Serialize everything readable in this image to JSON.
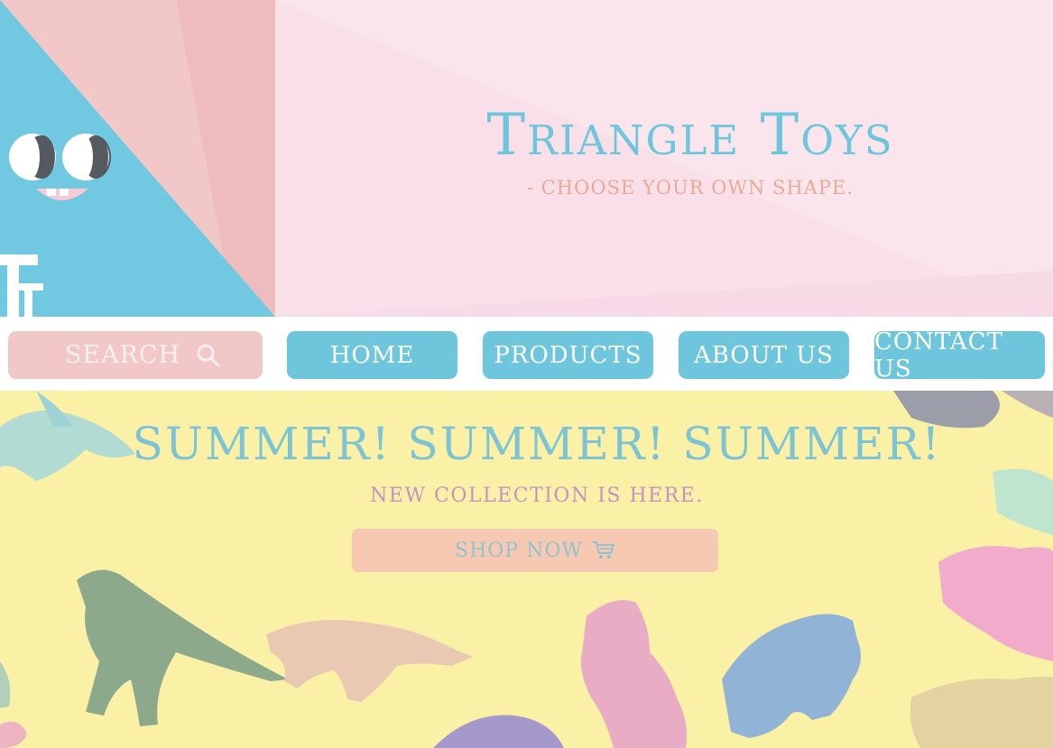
{
  "brand": {
    "title": "Triangle Toys",
    "tagline": "- CHOOSE YOUR OWN SHAPE.",
    "logo_icon": "triangle-face-logo"
  },
  "nav": {
    "search_label": "SEARCH",
    "search_icon": "search-icon",
    "items": [
      {
        "label": "HOME"
      },
      {
        "label": "PRODUCTS"
      },
      {
        "label": "ABOUT US"
      },
      {
        "label": "CONTACT US"
      }
    ]
  },
  "hero": {
    "title": "SUMMER! SUMMER! SUMMER!",
    "subtitle": "NEW COLLECTION IS HERE.",
    "cta_label": "SHOP NOW",
    "cta_icon": "cart-icon"
  },
  "colors": {
    "accent_blue": "#6ec6dc",
    "pink": "#f2c7c7",
    "header_bg": "#f8dfe8",
    "hero_bg": "#fbf1a6",
    "cta_peach": "#f7c8b2",
    "tagline_orange": "#eba996",
    "subtitle_purple": "#c393c5"
  }
}
